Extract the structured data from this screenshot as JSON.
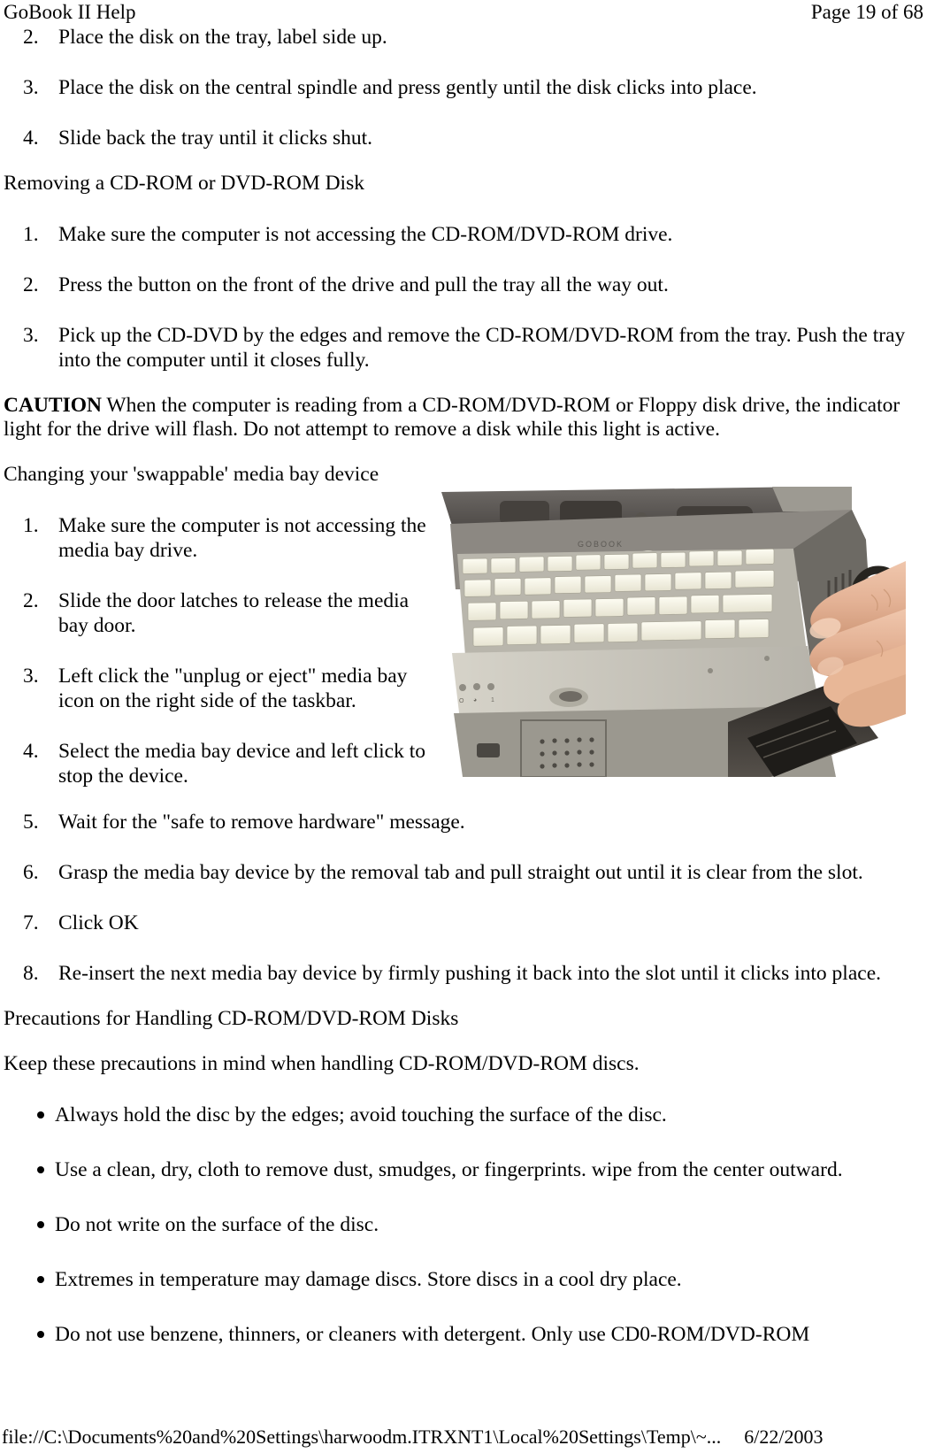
{
  "header": {
    "title": "GoBook II Help",
    "page_label": "Page 19 of 68"
  },
  "sections": {
    "insert_steps": [
      {
        "number": "2.",
        "text": "Place the disk on the tray, label side up."
      },
      {
        "number": "3.",
        "text": "Place the disk on the central spindle and press gently until the disk clicks into place."
      },
      {
        "number": "4.",
        "text": "Slide back the tray until it clicks shut."
      }
    ],
    "removing_heading": "Removing a CD-ROM or DVD-ROM Disk",
    "removing_steps": [
      {
        "number": "1.",
        "text": "Make sure the computer is not accessing the CD-ROM/DVD-ROM drive."
      },
      {
        "number": "2.",
        "text": "Press the button on the front of the drive and pull the tray all the way out."
      },
      {
        "number": "3.",
        "text": "Pick up the CD-DVD by the edges and remove the CD-ROM/DVD-ROM from the tray.  Push the tray into the computer until it closes fully."
      }
    ],
    "caution_label": "CAUTION",
    "caution_text": " When the computer is reading from a CD-ROM/DVD-ROM or Floppy disk drive, the indicator light for the drive will flash.  Do not attempt to remove a disk while this light is active.",
    "swappable_heading": "Changing your 'swappable' media bay device",
    "swappable_steps": [
      {
        "number": "1.",
        "text": "Make sure the computer is not accessing the media bay drive."
      },
      {
        "number": "2.",
        "text": "Slide the door latches to release the media bay door."
      },
      {
        "number": "3.",
        "text": "Left click the \"unplug or eject\" media bay icon on the right side of the taskbar."
      },
      {
        "number": "4.",
        "text": "Select the media bay device and left click to stop the device."
      },
      {
        "number": "5.",
        "text": "Wait for the \"safe to remove hardware\" message."
      },
      {
        "number": "6.",
        "text": "Grasp the media bay device by the removal tab and pull straight out until it is clear from the slot."
      },
      {
        "number": "7.",
        "text": "Click OK"
      },
      {
        "number": "8.",
        "text": "Re-insert the next media bay device by firmly pushing it back into the slot until it clicks into place."
      }
    ],
    "precautions_heading": "Precautions for Handling CD-ROM/DVD-ROM Disks",
    "precautions_intro": "Keep these precautions in mind when handling CD-ROM/DVD-ROM discs.",
    "precautions_bullets": [
      "Always hold the disc by the edges; avoid touching the surface of the disc.",
      "Use a clean, dry, cloth to remove dust, smudges, or fingerprints.  wipe from the center outward.",
      "Do not write on the surface of the disc.",
      "Extremes in temperature may damage discs.  Store discs in a cool dry place.",
      "Do not use benzene, thinners, or cleaners with detergent.  Only use CD0-ROM/DVD-ROM"
    ]
  },
  "figure": {
    "alt": "photograph of a rugged notebook computer with a hand pressing the media bay release on the right side",
    "name": "media-bay-photo"
  },
  "footer": {
    "path": "file://C:\\Documents%20and%20Settings\\harwoodm.ITRXNT1\\Local%20Settings\\Temp\\~...",
    "date": "6/22/2003"
  }
}
